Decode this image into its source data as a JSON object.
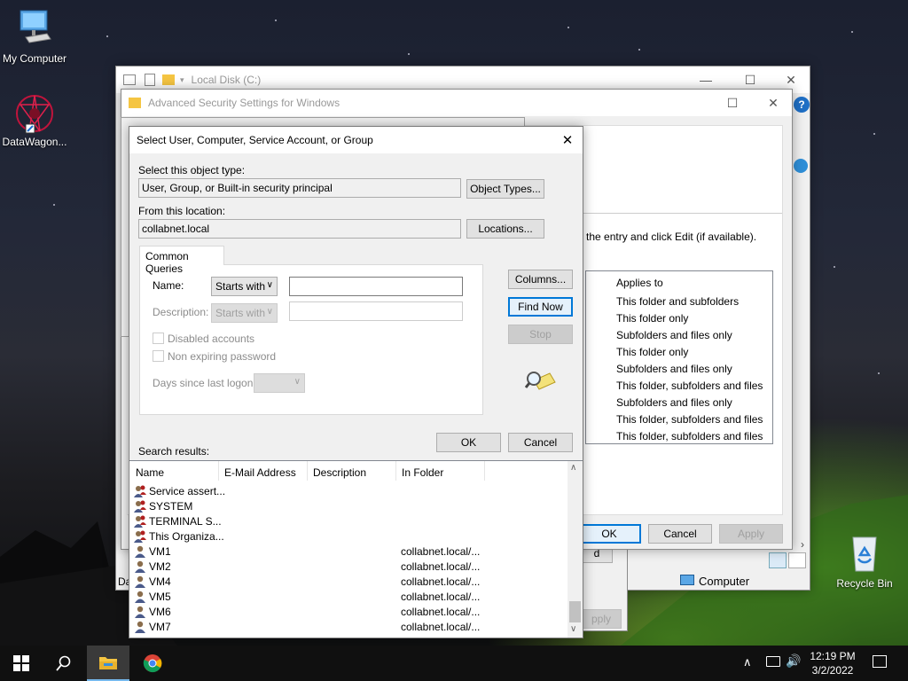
{
  "desktop": {
    "icons": [
      {
        "label": "My Computer"
      },
      {
        "label": "DataWagon..."
      },
      {
        "label": "Recycle Bin"
      }
    ]
  },
  "explorer": {
    "title": "Local Disk (C:)",
    "status_left": "Da",
    "status_computer": "Computer",
    "back_dialog_buttons": {
      "add": "d",
      "apply": "pply"
    }
  },
  "adv_security": {
    "title": "Advanced Security Settings for Windows",
    "instruction_tail": "the entry and click Edit (if available).",
    "applies_to_header": "Applies to",
    "applies_to": [
      "This folder and subfolders",
      "This folder only",
      "Subfolders and files only",
      "This folder only",
      "Subfolders and files only",
      "This folder, subfolders and files",
      "Subfolders and files only",
      "This folder, subfolders and files",
      "This folder, subfolders and files"
    ],
    "ok": "OK",
    "cancel": "Cancel",
    "apply": "Apply"
  },
  "dialog": {
    "title": "Select User, Computer, Service Account, or Group",
    "object_type_label": "Select this object type:",
    "object_type_value": "User, Group, or Built-in security principal",
    "object_types_btn": "Object Types...",
    "location_label": "From this location:",
    "location_value": "collabnet.local",
    "locations_btn": "Locations...",
    "tab": "Common Queries",
    "name_label": "Name:",
    "name_op": "Starts with",
    "desc_label": "Description:",
    "desc_op": "Starts with",
    "disabled_accounts": "Disabled accounts",
    "non_expiring": "Non expiring password",
    "days_since": "Days since last logon:",
    "columns_btn": "Columns...",
    "find_now_btn": "Find Now",
    "stop_btn": "Stop",
    "ok_btn": "OK",
    "cancel_btn": "Cancel",
    "search_results_label": "Search results:",
    "columns": [
      "Name",
      "E-Mail Address",
      "Description",
      "In Folder"
    ],
    "rows": [
      {
        "name": "Service assert...",
        "folder": "",
        "kind": "group"
      },
      {
        "name": "SYSTEM",
        "folder": "",
        "kind": "group"
      },
      {
        "name": "TERMINAL S...",
        "folder": "",
        "kind": "group"
      },
      {
        "name": "This Organiza...",
        "folder": "",
        "kind": "group"
      },
      {
        "name": "VM1",
        "folder": "collabnet.local/...",
        "kind": "user"
      },
      {
        "name": "VM2",
        "folder": "collabnet.local/...",
        "kind": "user"
      },
      {
        "name": "VM4",
        "folder": "collabnet.local/...",
        "kind": "user"
      },
      {
        "name": "VM5",
        "folder": "collabnet.local/...",
        "kind": "user"
      },
      {
        "name": "VM6",
        "folder": "collabnet.local/...",
        "kind": "user"
      },
      {
        "name": "VM7",
        "folder": "collabnet.local/...",
        "kind": "user"
      }
    ]
  },
  "taskbar": {
    "time": "12:19 PM",
    "date": "3/2/2022"
  }
}
